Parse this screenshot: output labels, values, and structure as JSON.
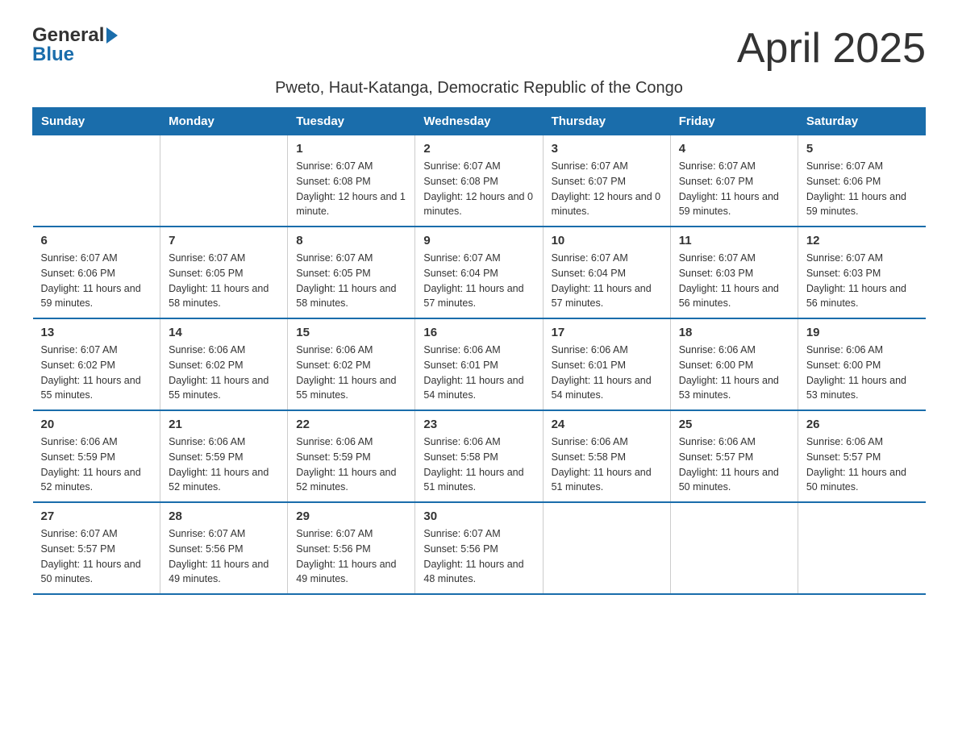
{
  "header": {
    "logo_general": "General",
    "logo_blue": "Blue",
    "month_year": "April 2025",
    "location": "Pweto, Haut-Katanga, Democratic Republic of the Congo"
  },
  "weekdays": [
    "Sunday",
    "Monday",
    "Tuesday",
    "Wednesday",
    "Thursday",
    "Friday",
    "Saturday"
  ],
  "weeks": [
    [
      {
        "day": "",
        "sunrise": "",
        "sunset": "",
        "daylight": ""
      },
      {
        "day": "",
        "sunrise": "",
        "sunset": "",
        "daylight": ""
      },
      {
        "day": "1",
        "sunrise": "Sunrise: 6:07 AM",
        "sunset": "Sunset: 6:08 PM",
        "daylight": "Daylight: 12 hours and 1 minute."
      },
      {
        "day": "2",
        "sunrise": "Sunrise: 6:07 AM",
        "sunset": "Sunset: 6:08 PM",
        "daylight": "Daylight: 12 hours and 0 minutes."
      },
      {
        "day": "3",
        "sunrise": "Sunrise: 6:07 AM",
        "sunset": "Sunset: 6:07 PM",
        "daylight": "Daylight: 12 hours and 0 minutes."
      },
      {
        "day": "4",
        "sunrise": "Sunrise: 6:07 AM",
        "sunset": "Sunset: 6:07 PM",
        "daylight": "Daylight: 11 hours and 59 minutes."
      },
      {
        "day": "5",
        "sunrise": "Sunrise: 6:07 AM",
        "sunset": "Sunset: 6:06 PM",
        "daylight": "Daylight: 11 hours and 59 minutes."
      }
    ],
    [
      {
        "day": "6",
        "sunrise": "Sunrise: 6:07 AM",
        "sunset": "Sunset: 6:06 PM",
        "daylight": "Daylight: 11 hours and 59 minutes."
      },
      {
        "day": "7",
        "sunrise": "Sunrise: 6:07 AM",
        "sunset": "Sunset: 6:05 PM",
        "daylight": "Daylight: 11 hours and 58 minutes."
      },
      {
        "day": "8",
        "sunrise": "Sunrise: 6:07 AM",
        "sunset": "Sunset: 6:05 PM",
        "daylight": "Daylight: 11 hours and 58 minutes."
      },
      {
        "day": "9",
        "sunrise": "Sunrise: 6:07 AM",
        "sunset": "Sunset: 6:04 PM",
        "daylight": "Daylight: 11 hours and 57 minutes."
      },
      {
        "day": "10",
        "sunrise": "Sunrise: 6:07 AM",
        "sunset": "Sunset: 6:04 PM",
        "daylight": "Daylight: 11 hours and 57 minutes."
      },
      {
        "day": "11",
        "sunrise": "Sunrise: 6:07 AM",
        "sunset": "Sunset: 6:03 PM",
        "daylight": "Daylight: 11 hours and 56 minutes."
      },
      {
        "day": "12",
        "sunrise": "Sunrise: 6:07 AM",
        "sunset": "Sunset: 6:03 PM",
        "daylight": "Daylight: 11 hours and 56 minutes."
      }
    ],
    [
      {
        "day": "13",
        "sunrise": "Sunrise: 6:07 AM",
        "sunset": "Sunset: 6:02 PM",
        "daylight": "Daylight: 11 hours and 55 minutes."
      },
      {
        "day": "14",
        "sunrise": "Sunrise: 6:06 AM",
        "sunset": "Sunset: 6:02 PM",
        "daylight": "Daylight: 11 hours and 55 minutes."
      },
      {
        "day": "15",
        "sunrise": "Sunrise: 6:06 AM",
        "sunset": "Sunset: 6:02 PM",
        "daylight": "Daylight: 11 hours and 55 minutes."
      },
      {
        "day": "16",
        "sunrise": "Sunrise: 6:06 AM",
        "sunset": "Sunset: 6:01 PM",
        "daylight": "Daylight: 11 hours and 54 minutes."
      },
      {
        "day": "17",
        "sunrise": "Sunrise: 6:06 AM",
        "sunset": "Sunset: 6:01 PM",
        "daylight": "Daylight: 11 hours and 54 minutes."
      },
      {
        "day": "18",
        "sunrise": "Sunrise: 6:06 AM",
        "sunset": "Sunset: 6:00 PM",
        "daylight": "Daylight: 11 hours and 53 minutes."
      },
      {
        "day": "19",
        "sunrise": "Sunrise: 6:06 AM",
        "sunset": "Sunset: 6:00 PM",
        "daylight": "Daylight: 11 hours and 53 minutes."
      }
    ],
    [
      {
        "day": "20",
        "sunrise": "Sunrise: 6:06 AM",
        "sunset": "Sunset: 5:59 PM",
        "daylight": "Daylight: 11 hours and 52 minutes."
      },
      {
        "day": "21",
        "sunrise": "Sunrise: 6:06 AM",
        "sunset": "Sunset: 5:59 PM",
        "daylight": "Daylight: 11 hours and 52 minutes."
      },
      {
        "day": "22",
        "sunrise": "Sunrise: 6:06 AM",
        "sunset": "Sunset: 5:59 PM",
        "daylight": "Daylight: 11 hours and 52 minutes."
      },
      {
        "day": "23",
        "sunrise": "Sunrise: 6:06 AM",
        "sunset": "Sunset: 5:58 PM",
        "daylight": "Daylight: 11 hours and 51 minutes."
      },
      {
        "day": "24",
        "sunrise": "Sunrise: 6:06 AM",
        "sunset": "Sunset: 5:58 PM",
        "daylight": "Daylight: 11 hours and 51 minutes."
      },
      {
        "day": "25",
        "sunrise": "Sunrise: 6:06 AM",
        "sunset": "Sunset: 5:57 PM",
        "daylight": "Daylight: 11 hours and 50 minutes."
      },
      {
        "day": "26",
        "sunrise": "Sunrise: 6:06 AM",
        "sunset": "Sunset: 5:57 PM",
        "daylight": "Daylight: 11 hours and 50 minutes."
      }
    ],
    [
      {
        "day": "27",
        "sunrise": "Sunrise: 6:07 AM",
        "sunset": "Sunset: 5:57 PM",
        "daylight": "Daylight: 11 hours and 50 minutes."
      },
      {
        "day": "28",
        "sunrise": "Sunrise: 6:07 AM",
        "sunset": "Sunset: 5:56 PM",
        "daylight": "Daylight: 11 hours and 49 minutes."
      },
      {
        "day": "29",
        "sunrise": "Sunrise: 6:07 AM",
        "sunset": "Sunset: 5:56 PM",
        "daylight": "Daylight: 11 hours and 49 minutes."
      },
      {
        "day": "30",
        "sunrise": "Sunrise: 6:07 AM",
        "sunset": "Sunset: 5:56 PM",
        "daylight": "Daylight: 11 hours and 48 minutes."
      },
      {
        "day": "",
        "sunrise": "",
        "sunset": "",
        "daylight": ""
      },
      {
        "day": "",
        "sunrise": "",
        "sunset": "",
        "daylight": ""
      },
      {
        "day": "",
        "sunrise": "",
        "sunset": "",
        "daylight": ""
      }
    ]
  ]
}
